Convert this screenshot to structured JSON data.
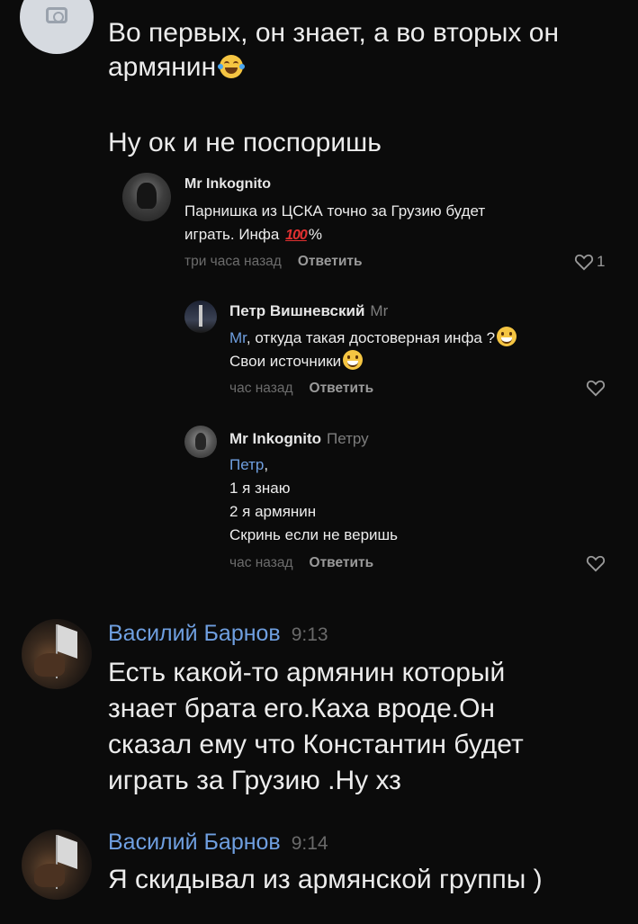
{
  "top_message": {
    "text": "Во первых, он знает, а во вторых он\nармянин",
    "emoji": "face-with-tears-of-joy",
    "text2": "Ну ок и не поспоришь"
  },
  "comments": [
    {
      "author": "Mr Inkognito",
      "reply_to": "",
      "lines": [
        "Парнишка из ЦСКА точно за Грузию будет",
        "играть. Инфа"
      ],
      "inline_emoji": "100",
      "tail": "%",
      "time": "три часа назад",
      "reply_label": "Ответить",
      "likes": "1"
    },
    {
      "author": "Петр Вишневский",
      "reply_to": "Mr",
      "mention": "Mr",
      "lines": [
        ", откуда такая достоверная инфа ?",
        "Свои источники"
      ],
      "time": "час назад",
      "reply_label": "Ответить"
    },
    {
      "author": "Mr Inkognito",
      "reply_to": "Петру",
      "mention": "Петр",
      "lines": [
        ",",
        "1 я знаю",
        "2 я армянин",
        "Скринь если не веришь"
      ],
      "time": "час назад",
      "reply_label": "Ответить"
    }
  ],
  "messages": [
    {
      "author": "Василий Барнов",
      "time": "9:13",
      "text": "Есть какой-то армянин который\nзнает брата его.Каха вроде.Он\nсказал ему что Константин будет\nиграть за Грузию .Ну хз"
    },
    {
      "author": "Василий Барнов",
      "time": "9:14",
      "text": "Я скидывал из армянской группы )"
    }
  ],
  "colors": {
    "background": "#0b0b0b",
    "link": "#6f9fe0",
    "muted": "#6c6c6c"
  }
}
